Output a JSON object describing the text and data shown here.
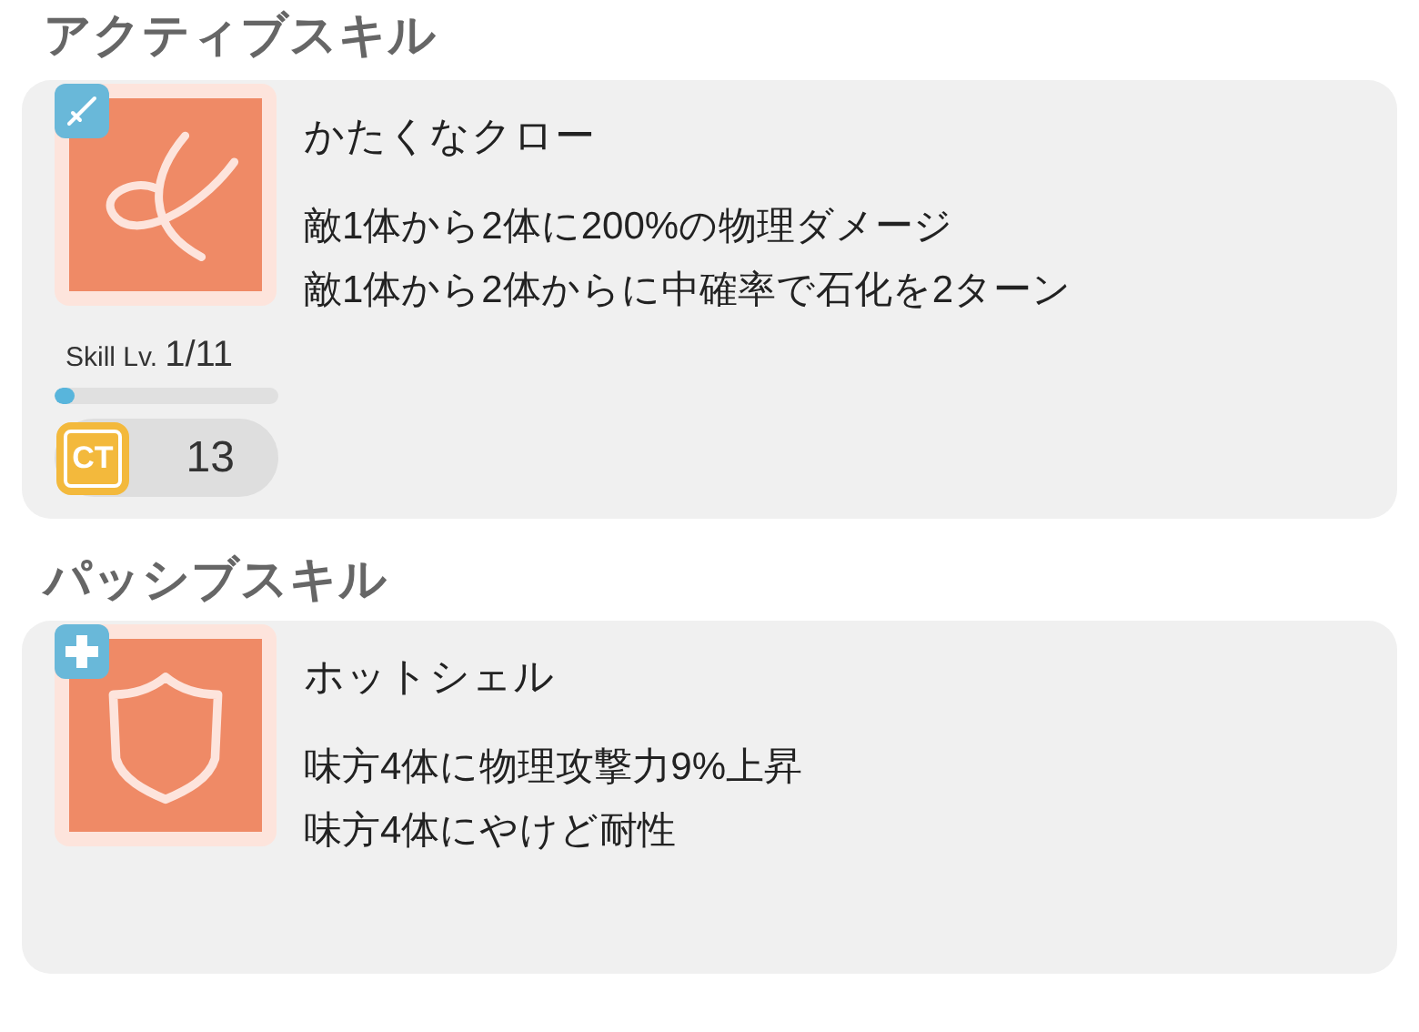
{
  "sections": [
    {
      "heading": "アクティブスキル",
      "skill": {
        "kind": "active",
        "name": "かたくなクロー",
        "effects": [
          "敵1体から2体に200%の物理ダメージ",
          "敵1体から2体からに中確率で石化を2ターン"
        ],
        "level_label": "Skill Lv.",
        "level_value": "1/11",
        "level": 0.09,
        "ct_label": "CT",
        "ct_value": "13"
      }
    },
    {
      "heading": "パッシブスキル",
      "skill": {
        "kind": "passive",
        "name": "ホットシェル",
        "effects": [
          "味方4体に物理攻撃力9%上昇",
          "味方4体にやけど耐性"
        ]
      }
    }
  ]
}
